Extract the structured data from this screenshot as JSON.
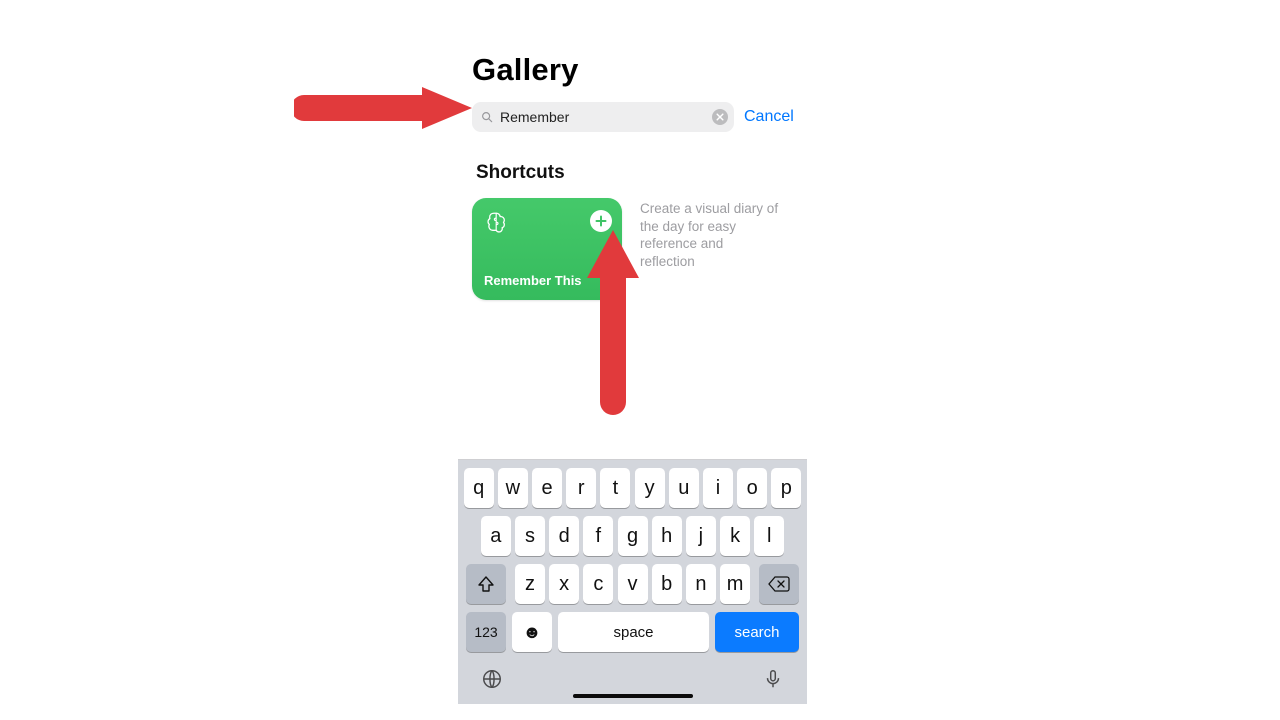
{
  "header": {
    "title": "Gallery"
  },
  "search": {
    "value": "Remember",
    "cancel_label": "Cancel"
  },
  "section": {
    "heading": "Shortcuts"
  },
  "result": {
    "card_title": "Remember This",
    "description": "Create a visual diary of the day for easy reference and reflection"
  },
  "keyboard": {
    "row1": [
      "q",
      "w",
      "e",
      "r",
      "t",
      "y",
      "u",
      "i",
      "o",
      "p"
    ],
    "row2": [
      "a",
      "s",
      "d",
      "f",
      "g",
      "h",
      "j",
      "k",
      "l"
    ],
    "row3": [
      "z",
      "x",
      "c",
      "v",
      "b",
      "n",
      "m"
    ],
    "n123": "123",
    "space": "space",
    "search": "search"
  },
  "colors": {
    "accent_green": "#3fc466",
    "ios_blue": "#0a84ff",
    "arrow_red": "#e13a3c"
  }
}
